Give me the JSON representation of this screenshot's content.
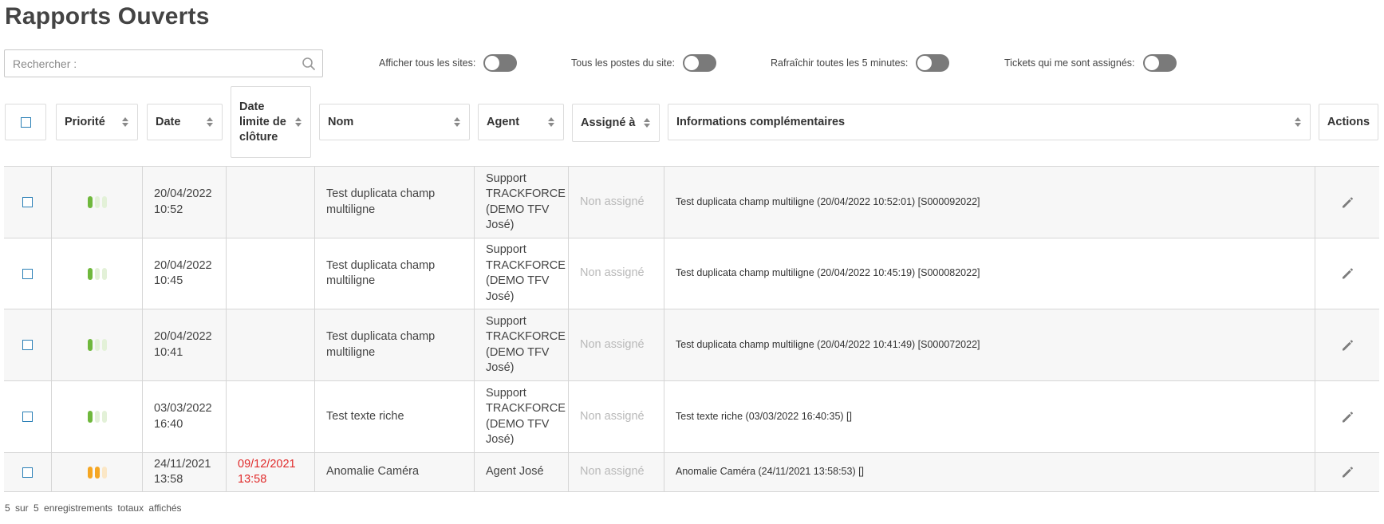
{
  "page": {
    "title": "Rapports Ouverts"
  },
  "search": {
    "placeholder": "Rechercher :",
    "value": ""
  },
  "toggles": [
    {
      "label": "Afficher tous les sites:",
      "on": false
    },
    {
      "label": "Tous les postes du site:",
      "on": false
    },
    {
      "label": "Rafraîchir toutes les 5 minutes:",
      "on": false
    },
    {
      "label": "Tickets qui me sont assignés:",
      "on": false
    }
  ],
  "table": {
    "columns": {
      "priority": "Priorité",
      "date": "Date",
      "deadline": "Date limite de clôture",
      "name": "Nom",
      "agent": "Agent",
      "assigned": "Assigné à",
      "info": "Informations complémentaires",
      "actions": "Actions"
    },
    "rows": [
      {
        "priority": "low",
        "date": "20/04/2022 10:52",
        "deadline": "",
        "name": "Test duplicata champ multiligne",
        "agent": "Support TRACKFORCE (DEMO TFV José)",
        "assigned": "Non assigné",
        "info": "Test duplicata champ multiligne (20/04/2022 10:52:01) [S000092022]"
      },
      {
        "priority": "low",
        "date": "20/04/2022 10:45",
        "deadline": "",
        "name": "Test duplicata champ multiligne",
        "agent": "Support TRACKFORCE (DEMO TFV José)",
        "assigned": "Non assigné",
        "info": "Test duplicata champ multiligne (20/04/2022 10:45:19) [S000082022]"
      },
      {
        "priority": "low",
        "date": "20/04/2022 10:41",
        "deadline": "",
        "name": "Test duplicata champ multiligne",
        "agent": "Support TRACKFORCE (DEMO TFV José)",
        "assigned": "Non assigné",
        "info": "Test duplicata champ multiligne (20/04/2022 10:41:49) [S000072022]"
      },
      {
        "priority": "low",
        "date": "03/03/2022 16:40",
        "deadline": "",
        "name": "Test texte riche",
        "agent": "Support TRACKFORCE (DEMO TFV José)",
        "assigned": "Non assigné",
        "info": "Test texte riche (03/03/2022 16:40:35) []"
      },
      {
        "priority": "medium",
        "date": "24/11/2021 13:58",
        "deadline": "09/12/2021 13:58",
        "name": "Anomalie Caméra",
        "agent": "Agent José",
        "assigned": "Non assigné",
        "info": "Anomalie Caméra (24/11/2021 13:58:53) []"
      }
    ]
  },
  "footer": {
    "text": "5 sur 5 enregistrements totaux affichés"
  },
  "colors": {
    "priority_low": [
      "#6fb83c",
      "#e3f1d8",
      "#e3f1d8"
    ],
    "priority_medium": [
      "#f5a623",
      "#f5a623",
      "#fbe7c6"
    ],
    "deadline": "#e02a2a",
    "checkbox": "#2a7fb6",
    "toggle_off": "#7a7a7a"
  },
  "icons": {
    "search": "search-icon",
    "sort": "sort-icon",
    "edit": "pencil-icon"
  }
}
